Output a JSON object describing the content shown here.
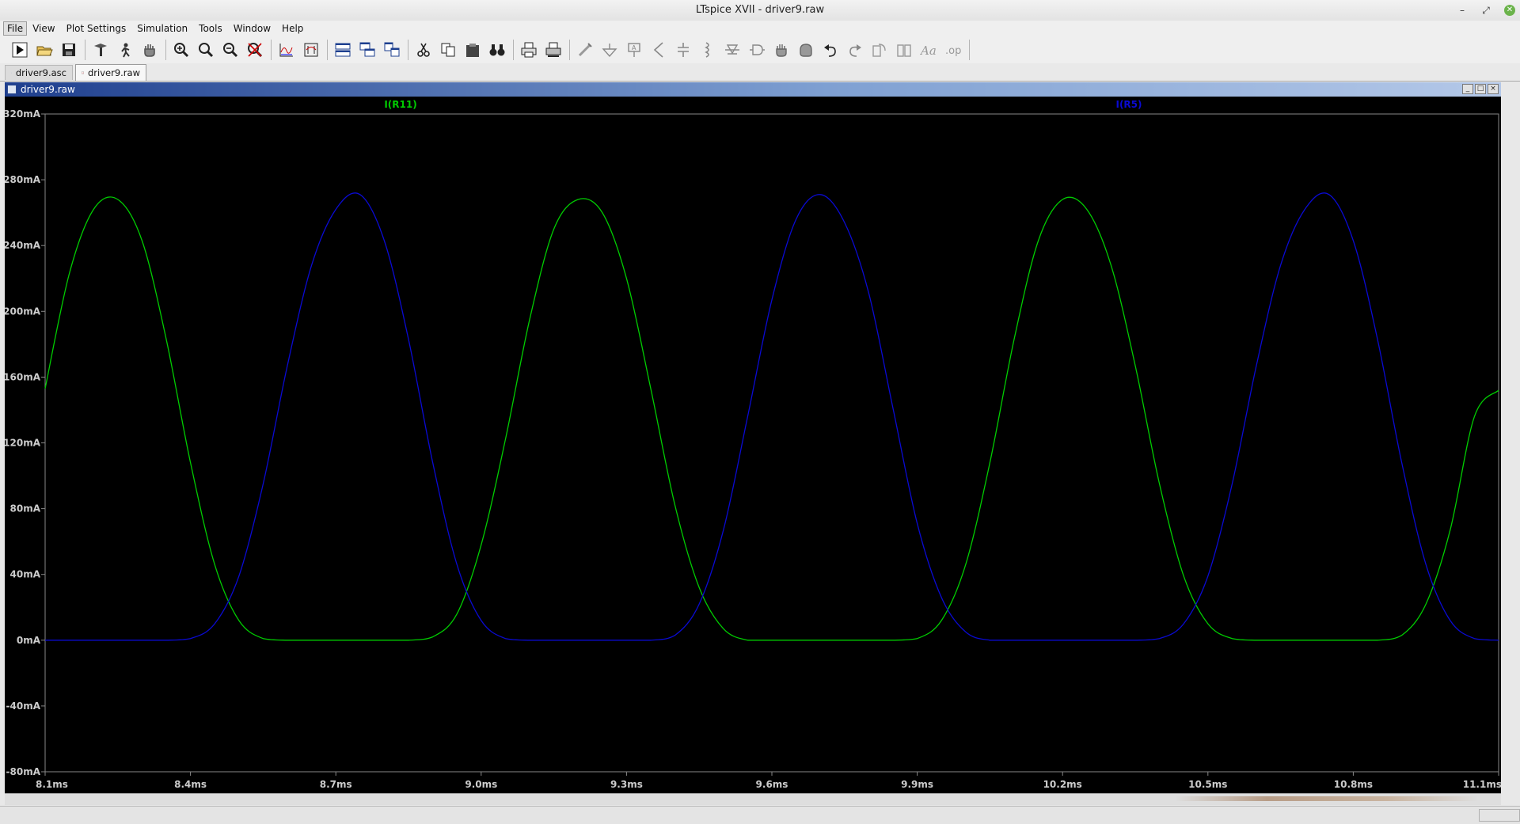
{
  "window": {
    "title": "LTspice XVII - driver9.raw"
  },
  "window_controls": [
    "minimize",
    "restore",
    "close"
  ],
  "menu": [
    "File",
    "View",
    "Plot Settings",
    "Simulation",
    "Tools",
    "Window",
    "Help"
  ],
  "toolbar": {
    "groups": [
      [
        "run-icon",
        "open-icon",
        "save-icon"
      ],
      [
        "control-panel-icon",
        "halt-icon",
        "pan-hand-icon"
      ],
      [
        "zoom-in-icon",
        "zoom-area-icon",
        "zoom-out-icon",
        "zoom-cancel-icon"
      ],
      [
        "autorange-icon",
        "rescale-icon"
      ],
      [
        "tile-horizontal-icon",
        "cascade-icon",
        "tile-vertical-icon"
      ],
      [
        "cut-icon",
        "copy-icon",
        "paste-icon",
        "find-icon"
      ],
      [
        "print-icon",
        "print-setup-icon"
      ],
      [
        "wire-icon",
        "ground-icon",
        "label-icon",
        "resistor-icon",
        "capacitor-icon",
        "inductor-icon",
        "diode-icon",
        "component-icon",
        "move-icon",
        "drag-icon",
        "undo-icon",
        "redo-icon",
        "rotate-icon",
        "mirror-icon",
        "text-icon",
        "spice-directive-icon"
      ]
    ]
  },
  "tabs": [
    {
      "label": "driver9.asc",
      "icon": "schematic-icon",
      "active": false
    },
    {
      "label": "driver9.raw",
      "icon": "waveform-icon",
      "active": true
    }
  ],
  "child_window": {
    "title": "driver9.raw",
    "buttons": [
      "_",
      "□",
      "×"
    ]
  },
  "status": {
    "text": ""
  },
  "colors": {
    "plot_bg": "#000000",
    "grid": "#888888",
    "i_r11": "#00cc00",
    "i_r5": "#0a0ad2",
    "axis_label": "#cccccc"
  },
  "chart_data": {
    "type": "line",
    "title": "",
    "xlabel": "",
    "ylabel": "",
    "xlim": [
      8.1,
      11.1
    ],
    "ylim": [
      -80,
      320
    ],
    "x_unit": "ms",
    "y_unit": "mA",
    "xticks": [
      "8.1ms",
      "8.4ms",
      "8.7ms",
      "9.0ms",
      "9.3ms",
      "9.6ms",
      "9.9ms",
      "10.2ms",
      "10.5ms",
      "10.8ms",
      "11.1ms"
    ],
    "yticks": [
      "320mA",
      "280mA",
      "240mA",
      "200mA",
      "160mA",
      "120mA",
      "80mA",
      "40mA",
      "0mA",
      "-40mA",
      "-80mA"
    ],
    "grid": false,
    "series": [
      {
        "name": "I(R11)",
        "x": [
          8.1,
          8.15,
          8.2,
          8.25,
          8.3,
          8.35,
          8.4,
          8.45,
          8.5,
          8.55,
          8.6,
          8.65,
          8.7,
          8.75,
          8.8,
          8.85,
          8.9,
          8.95,
          9.0,
          9.05,
          9.1,
          9.15,
          9.2,
          9.25,
          9.3,
          9.35,
          9.4,
          9.45,
          9.5,
          9.55,
          9.6,
          9.65,
          9.7,
          9.75,
          9.8,
          9.85,
          9.9,
          9.95,
          10.0,
          10.05,
          10.1,
          10.15,
          10.2,
          10.25,
          10.3,
          10.35,
          10.4,
          10.45,
          10.5,
          10.55,
          10.6,
          10.65,
          10.7,
          10.75,
          10.8,
          10.85,
          10.9,
          10.95,
          11.0,
          11.05,
          11.1
        ],
        "y": [
          153,
          223,
          262,
          268,
          243,
          183,
          108,
          46,
          12,
          1,
          0,
          0,
          0,
          0,
          0,
          0,
          2,
          16,
          58,
          122,
          195,
          250,
          268,
          260,
          220,
          153,
          82,
          32,
          7,
          0,
          0,
          0,
          0,
          0,
          0,
          0,
          1,
          12,
          46,
          108,
          183,
          243,
          268,
          262,
          228,
          167,
          95,
          39,
          10,
          1,
          0,
          0,
          0,
          0,
          0,
          0,
          3,
          22,
          67,
          136,
          152
        ]
      },
      {
        "name": "I(R5)",
        "x": [
          8.1,
          8.15,
          8.2,
          8.25,
          8.3,
          8.35,
          8.4,
          8.45,
          8.5,
          8.55,
          8.6,
          8.65,
          8.7,
          8.75,
          8.8,
          8.85,
          8.9,
          8.95,
          9.0,
          9.05,
          9.1,
          9.15,
          9.2,
          9.25,
          9.3,
          9.35,
          9.4,
          9.45,
          9.5,
          9.55,
          9.6,
          9.65,
          9.7,
          9.75,
          9.8,
          9.85,
          9.9,
          9.95,
          10.0,
          10.05,
          10.1,
          10.15,
          10.2,
          10.25,
          10.3,
          10.35,
          10.4,
          10.45,
          10.5,
          10.55,
          10.6,
          10.65,
          10.7,
          10.75,
          10.8,
          10.85,
          10.9,
          10.95,
          11.0,
          11.05,
          11.1
        ],
        "y": [
          0,
          0,
          0,
          0,
          0,
          0,
          1,
          10,
          39,
          95,
          167,
          228,
          262,
          271,
          243,
          183,
          108,
          46,
          12,
          1,
          0,
          0,
          0,
          0,
          0,
          0,
          3,
          22,
          67,
          136,
          207,
          256,
          271,
          254,
          211,
          141,
          71,
          26,
          5,
          0,
          0,
          0,
          0,
          0,
          0,
          0,
          1,
          10,
          39,
          95,
          167,
          228,
          262,
          271,
          243,
          183,
          108,
          46,
          12,
          1,
          0
        ]
      }
    ]
  }
}
